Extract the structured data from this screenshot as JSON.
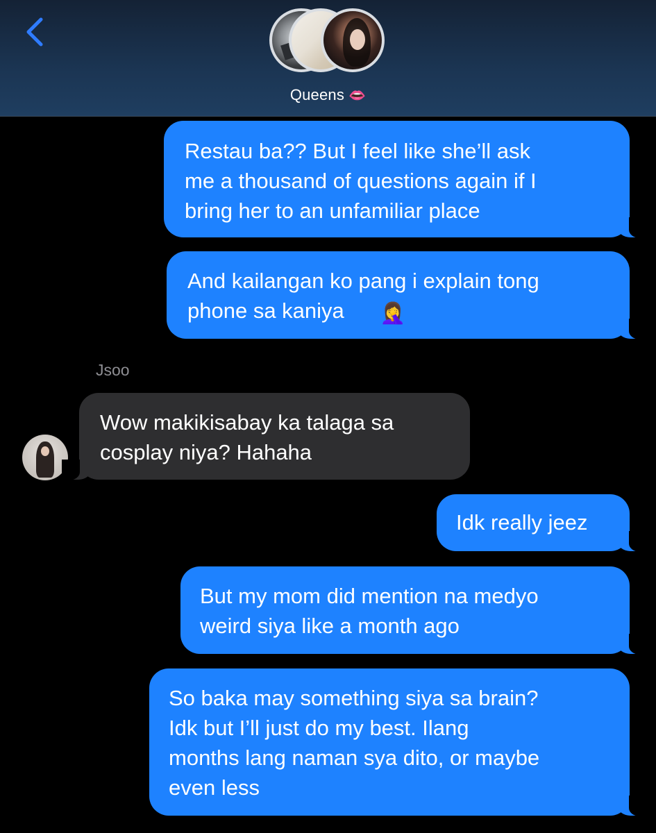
{
  "header": {
    "back_icon": "chevron-left-icon",
    "group_name": "Queens",
    "group_emoji": "👄",
    "accent": "#2f7cff"
  },
  "messages": [
    {
      "direction": "outgoing",
      "text": "Restau ba?? But I feel like she’ll ask\nme a thousand of questions again if I\nbring her to an unfamiliar place"
    },
    {
      "direction": "outgoing",
      "text": "And kailangan ko pang i explain tong\nphone sa kaniya",
      "emoji": "🤦‍♀️"
    },
    {
      "direction": "incoming",
      "sender": "Jsoo",
      "text": "Wow makikisabay ka talaga sa\ncosplay niya? Hahaha"
    },
    {
      "direction": "outgoing",
      "text": "Idk really jeez"
    },
    {
      "direction": "outgoing",
      "text": "But my mom did mention na medyo\nweird siya like a month ago"
    },
    {
      "direction": "outgoing",
      "text": "So baka may something siya sa brain?\nIdk but I’ll just do my best. Ilang\nmonths lang naman sya dito, or maybe\neven less"
    }
  ],
  "colors": {
    "outgoing_bubble": "#1e82ff",
    "incoming_bubble": "#2e2e30",
    "background": "#000000",
    "sender_name": "#8e8e93"
  }
}
